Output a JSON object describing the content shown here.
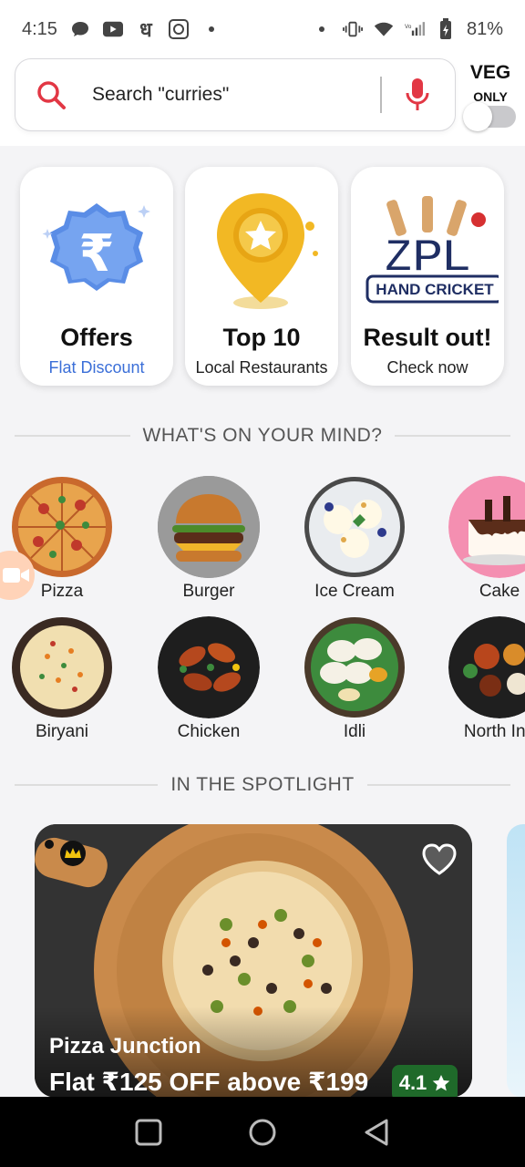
{
  "status_bar": {
    "time": "4:15",
    "battery": "81%",
    "icons": [
      "chat-bubble-icon",
      "youtube-icon",
      "hindi-char-icon",
      "app-badge-icon",
      "dot-icon",
      "vibrate-icon",
      "wifi-icon",
      "signal-icon",
      "battery-icon"
    ],
    "hindi_glyph": "ध"
  },
  "search": {
    "placeholder": "Search \"curries\"",
    "accent": "#e23744"
  },
  "veg_toggle": {
    "label": "VEG",
    "sublabel": "ONLY",
    "enabled": false
  },
  "cards": [
    {
      "title": "Offers",
      "subtitle": "Flat Discount",
      "icon": "rupee-badge-icon"
    },
    {
      "title": "Top 10",
      "subtitle": "Local Restaurants",
      "icon": "star-pin-icon"
    },
    {
      "title": "Result out!",
      "subtitle": "Check now",
      "icon": "zpl-cricket-logo",
      "logo_text": "ZPL",
      "logo_sub": "HAND CRICKET"
    }
  ],
  "sections": {
    "mind": "WHAT'S ON YOUR MIND?",
    "spotlight": "IN THE SPOTLIGHT"
  },
  "categories": [
    {
      "label": "Pizza"
    },
    {
      "label": "Burger"
    },
    {
      "label": "Ice Cream"
    },
    {
      "label": "Cake"
    },
    {
      "label": "Biryani"
    },
    {
      "label": "Chicken"
    },
    {
      "label": "Idli"
    },
    {
      "label": "North Ind"
    }
  ],
  "spotlight": {
    "name": "Pizza Junction",
    "offer": "Flat ₹125 OFF above ₹199",
    "rating": "4.1"
  }
}
